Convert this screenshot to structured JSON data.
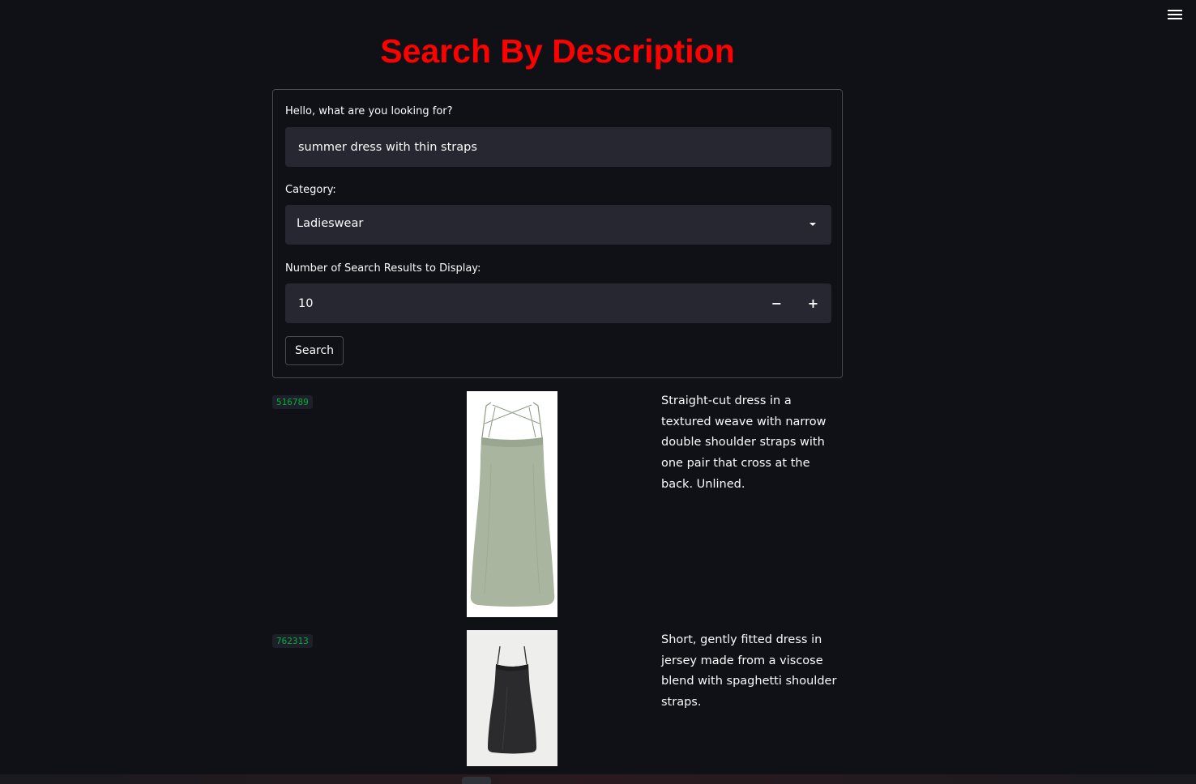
{
  "page": {
    "title": "Search By Description",
    "menu_icon": "hamburger-icon"
  },
  "form": {
    "query_label": "Hello, what are you looking for?",
    "query_value": "summer dress with thin straps",
    "category_label": "Category:",
    "category_value": "Ladieswear",
    "count_label": "Number of Search Results to Display:",
    "count_value": "10",
    "decrement_label": "−",
    "increment_label": "+",
    "search_label": "Search"
  },
  "results": [
    {
      "article_id": "516789",
      "description": "Straight-cut dress in a textured weave with narrow double shoulder straps with one pair that cross at the back. Unlined."
    },
    {
      "article_id": "762313",
      "description": "Short, gently fitted dress in jersey made from a viscose blend with spaghetti shoulder straps."
    }
  ],
  "colors": {
    "background": "#0f1117",
    "title": "#ff0000",
    "field_bg": "#262730",
    "id_green": "#09ab3b",
    "dress_1": "#a9b59f",
    "dress_2": "#2b2b2d"
  }
}
